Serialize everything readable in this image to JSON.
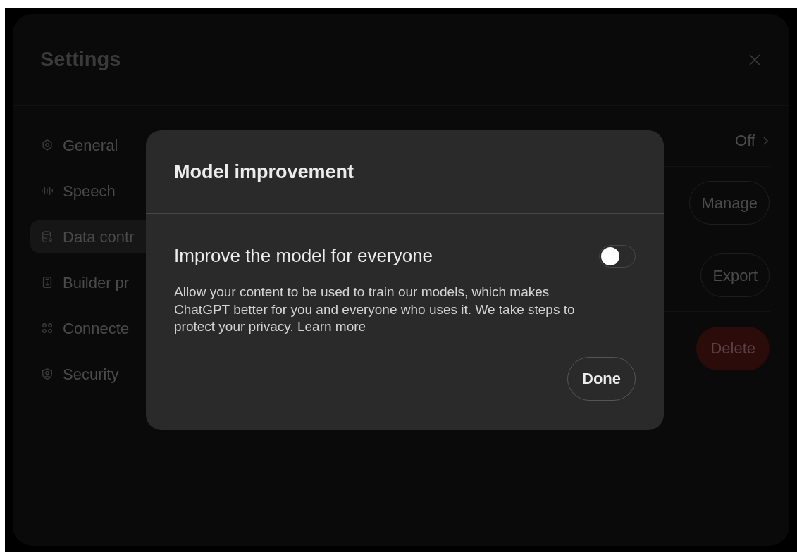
{
  "settings": {
    "title": "Settings",
    "sidebar": {
      "items": [
        {
          "label": "General",
          "selected": false
        },
        {
          "label": "Speech",
          "selected": false
        },
        {
          "label": "Data contr",
          "selected": true
        },
        {
          "label": "Builder pr",
          "selected": false
        },
        {
          "label": "Connecte",
          "selected": false
        },
        {
          "label": "Security",
          "selected": false
        }
      ]
    },
    "rows": [
      {
        "kind": "value",
        "value": "Off"
      },
      {
        "kind": "button",
        "button": "Manage"
      },
      {
        "kind": "button",
        "button": "Export"
      },
      {
        "kind": "danger",
        "button": "Delete"
      }
    ]
  },
  "modal": {
    "title": "Model improvement",
    "setting": {
      "label": "Improve the model for everyone",
      "on": false
    },
    "description": "Allow your content to be used to train our models, which makes ChatGPT better for you and everyone who uses it. We take steps to protect your privacy.",
    "link": "Learn more",
    "button": "Done"
  }
}
